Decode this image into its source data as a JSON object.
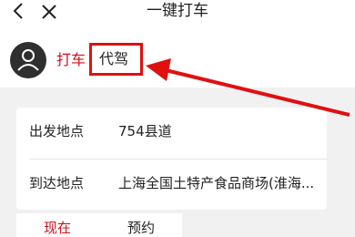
{
  "header": {
    "title": "一键打车",
    "back_icon": "chevron-left-icon",
    "close_icon": "close-icon"
  },
  "mode_switch": {
    "avatar_icon": "user-avatar-icon",
    "taxi_label": "打车",
    "driver_label": "代驾"
  },
  "trip": {
    "from_label": "出发地点",
    "from_value": "754县道",
    "to_label": "到达地点",
    "to_value": "上海全国土特产食品商场(淮海..."
  },
  "time_tabs": {
    "now_label": "现在",
    "book_label": "预约"
  },
  "colors": {
    "accent": "#d0101e",
    "annotation": "#e01010",
    "background_gray": "#f1f1f1"
  }
}
